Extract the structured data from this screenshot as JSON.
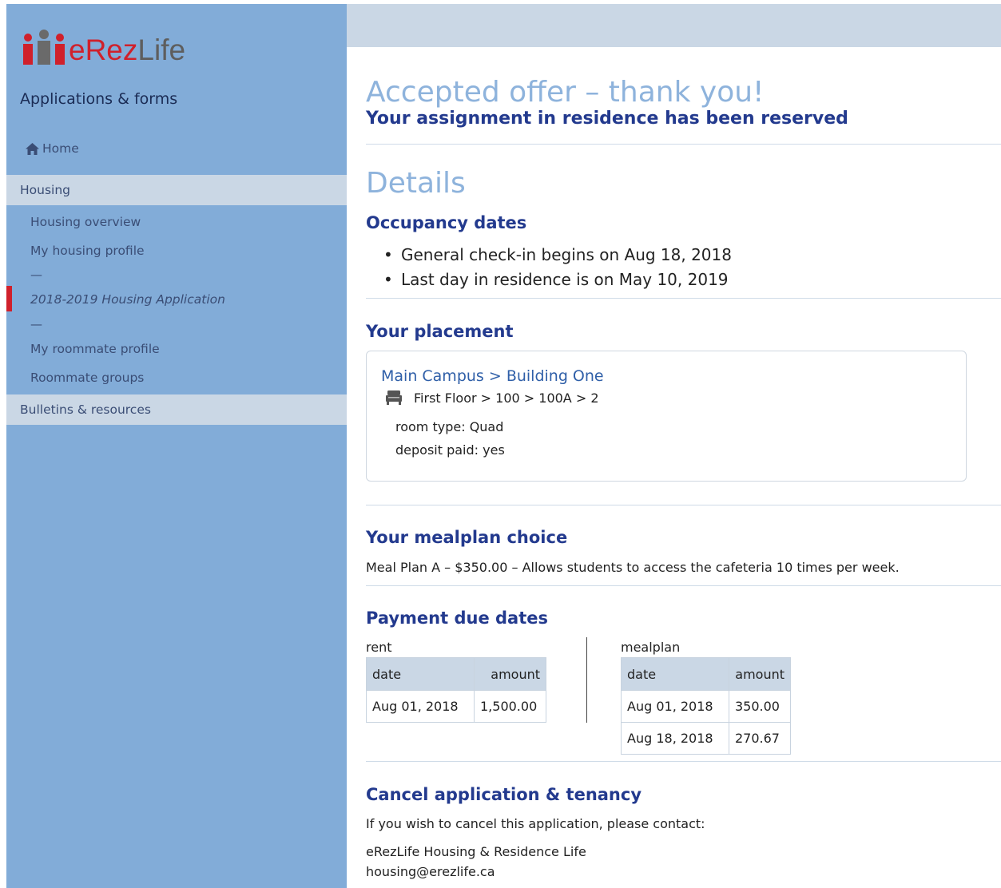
{
  "brand": {
    "name_red": "eRez",
    "name_gray": "Life",
    "colors": {
      "red": "#d0202b",
      "gray": "#5e5e5e",
      "sidebar": "#82acd8",
      "heading": "#233a8e",
      "title": "#8eb3dc"
    }
  },
  "sidebar": {
    "app_title": "Applications & forms",
    "home": {
      "icon": "home-icon",
      "label": "Home"
    },
    "sections": [
      {
        "label": "Housing"
      },
      {
        "label": "Bulletins & resources"
      }
    ],
    "housing_items": [
      {
        "label": "Housing overview"
      },
      {
        "label": "My housing profile"
      },
      {
        "label": "2018-2019 Housing Application",
        "active": true
      },
      {
        "label": "My roommate profile"
      },
      {
        "label": "Roommate groups"
      }
    ],
    "separator": "—"
  },
  "page": {
    "title": "Accepted offer – thank you!",
    "subtitle": "Your assignment in residence has been reserved",
    "details_title": "Details",
    "occupancy": {
      "heading": "Occupancy dates",
      "items": [
        "General check-in begins on Aug 18, 2018",
        "Last day in residence is on May 10, 2019"
      ]
    },
    "placement": {
      "heading": "Your placement",
      "location": "Main Campus > Building One",
      "bed_icon": "bed-icon",
      "path": "First Floor > 100 > 100A > 2",
      "room_type": "room type: Quad",
      "deposit": "deposit paid: yes"
    },
    "mealplan": {
      "heading": "Your mealplan choice",
      "text": "Meal Plan A – $350.00 – Allows students to access the cafeteria 10 times per week."
    },
    "payment": {
      "heading": "Payment due dates",
      "rent": {
        "label": "rent",
        "headers": [
          "date",
          "amount"
        ],
        "rows": [
          [
            "Aug 01, 2018",
            "1,500.00"
          ]
        ]
      },
      "mealplan": {
        "label": "mealplan",
        "headers": [
          "date",
          "amount"
        ],
        "rows": [
          [
            "Aug 01, 2018",
            "350.00"
          ],
          [
            "Aug 18, 2018",
            "270.67"
          ]
        ]
      }
    },
    "cancel": {
      "heading": "Cancel application & tenancy",
      "text": "If you wish to cancel this application, please contact:",
      "org": "eRezLife Housing & Residence Life",
      "email": "housing@erezlife.ca"
    }
  }
}
